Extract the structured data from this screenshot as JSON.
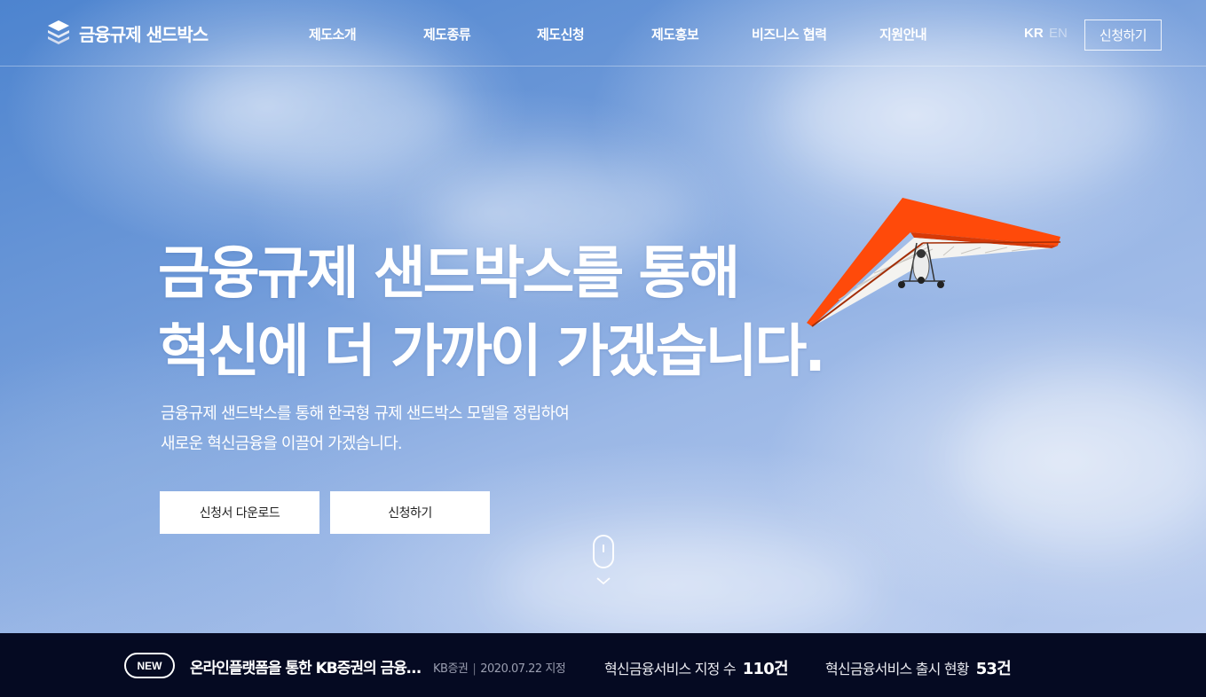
{
  "header": {
    "logo_text": "금융규제 샌드박스",
    "nav": [
      "제도소개",
      "제도종류",
      "제도신청",
      "제도홍보",
      "비즈니스 협력",
      "지원안내"
    ],
    "lang_kr": "KR",
    "lang_en": "EN",
    "apply_label": "신청하기"
  },
  "hero": {
    "headline_line1": "금융규제 샌드박스를 통해",
    "headline_line2": "혁신에 더 가까이 가겠습니다.",
    "sub_line1": "금융규제 샌드박스를 통해 한국형 규제 샌드박스 모델을 정립하여",
    "sub_line2": "새로운 혁신금융을 이끌어 가겠습니다.",
    "download_label": "신청서 다운로드",
    "apply_label": "신청하기"
  },
  "bottom": {
    "new_badge": "NEW",
    "news_title": "온라인플랫폼을 통한 KB증권의 금융상품 판매",
    "news_company": "KB증권",
    "news_date": "2020.07.22 지정",
    "stat1_label": "혁신금융서비스 지정 수",
    "stat1_value": "110건",
    "stat2_label": "혁신금융서비스 출시 현황",
    "stat2_value": "53건"
  },
  "colors": {
    "bottom_bar": "#050a22",
    "glider_orange": "#ff4a0a"
  }
}
